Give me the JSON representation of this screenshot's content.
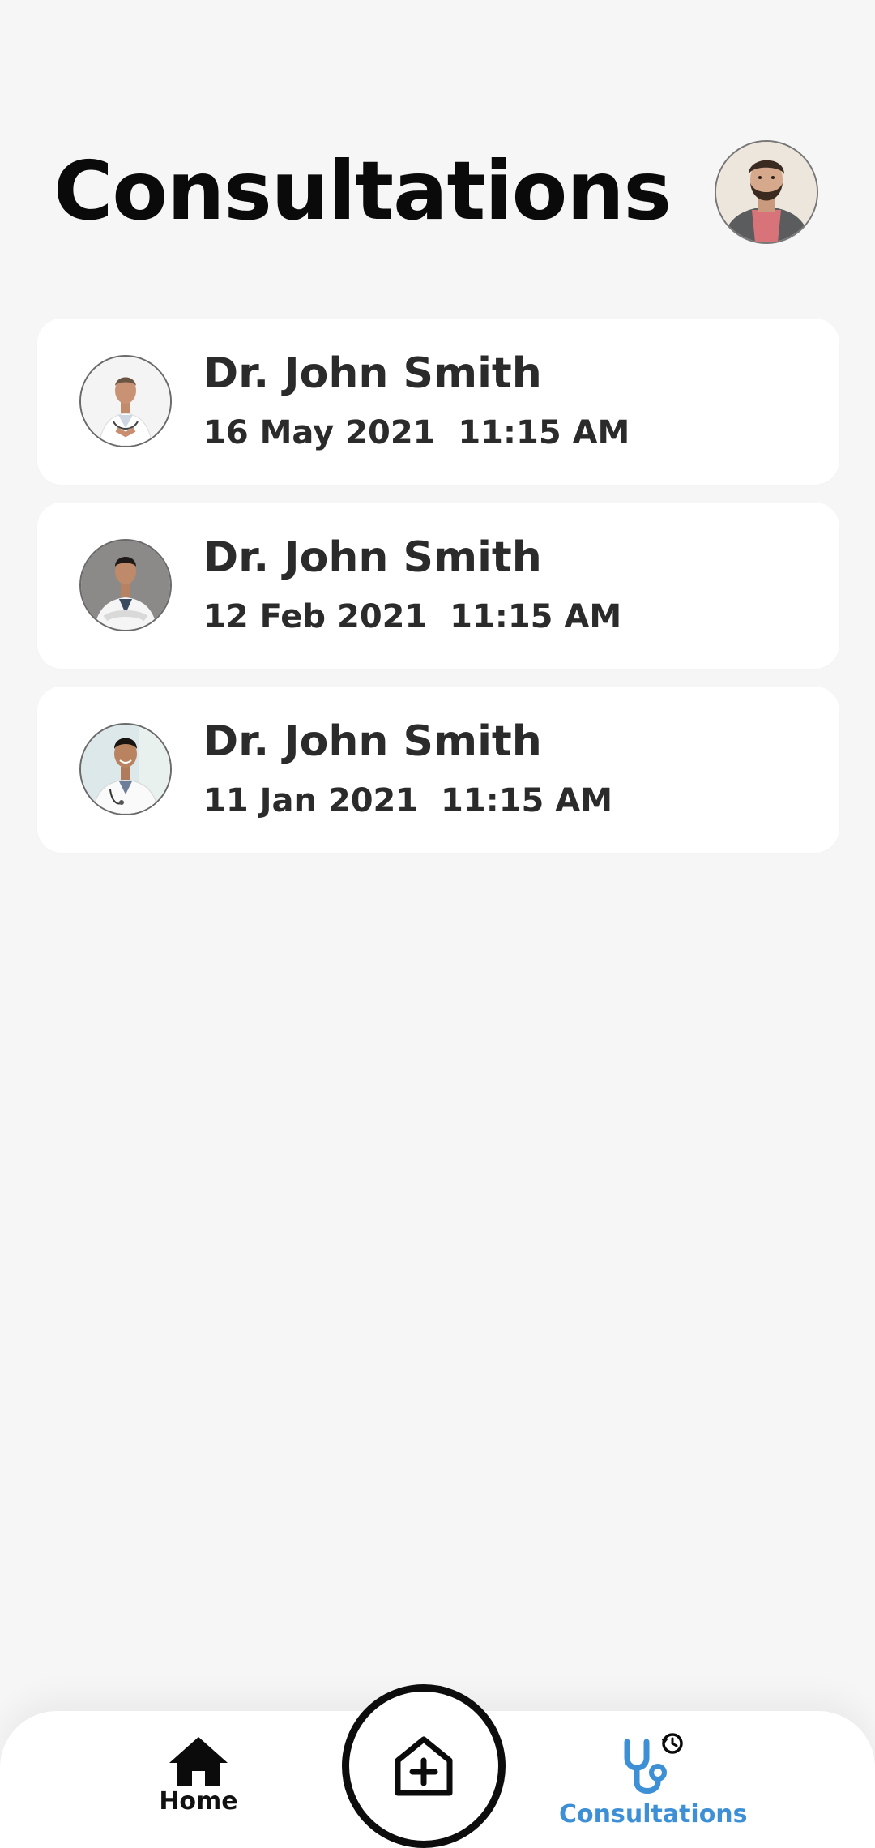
{
  "header": {
    "title": "Consultations",
    "user_avatar_icon": "user-avatar-photo"
  },
  "consultations": [
    {
      "doctor_name": "Dr. John Smith",
      "datetime": "16 May 2021  11:15 AM",
      "avatar_icon": "doctor-avatar-photo"
    },
    {
      "doctor_name": "Dr. John Smith",
      "datetime": "12 Feb 2021  11:15 AM",
      "avatar_icon": "doctor-avatar-photo"
    },
    {
      "doctor_name": "Dr. John Smith",
      "datetime": "11 Jan 2021  11:15 AM",
      "avatar_icon": "doctor-avatar-photo"
    }
  ],
  "bottom_nav": {
    "home_label": "Home",
    "home_icon": "home-icon",
    "add_icon": "hospital-plus-icon",
    "consultations_label": "Consultations",
    "consultations_icon": "stethoscope-history-icon",
    "active_tab": "Consultations"
  },
  "colors": {
    "background": "#f6f6f6",
    "card": "#ffffff",
    "accent": "#3d8fd6",
    "text": "#2b2b2b"
  }
}
